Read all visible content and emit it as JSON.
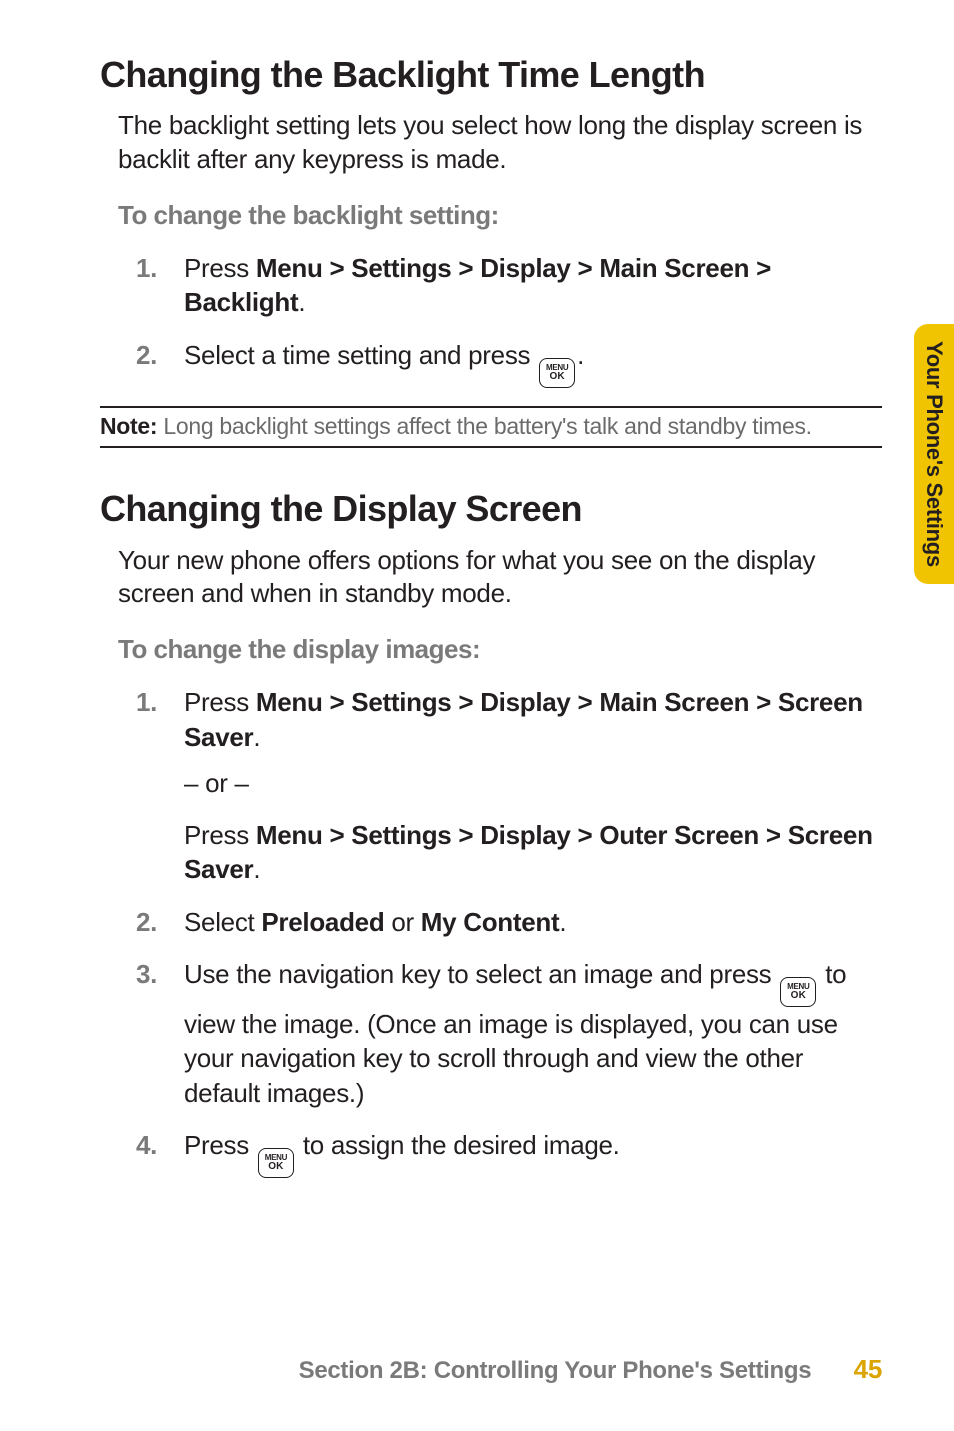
{
  "side_tab": "Your Phone's Settings",
  "section1": {
    "heading": "Changing the Backlight Time Length",
    "intro": "The backlight setting lets you select how long the display screen is backlit after any keypress is made.",
    "lead": "To change the backlight setting:",
    "step1_num": "1.",
    "step1_pre": "Press ",
    "step1_bold": "Menu > Settings > Display > Main Screen > Backlight",
    "step1_post": ".",
    "step2_num": "2.",
    "step2_pre": "Select a time setting and press ",
    "step2_post": "."
  },
  "icon": {
    "line1": "MENU",
    "line2": "OK"
  },
  "note": {
    "label": "Note:",
    "text": " Long backlight settings affect the battery's talk and standby times."
  },
  "section2": {
    "heading": "Changing the Display Screen",
    "intro": "Your new phone offers options for what you see on the display screen and when in standby mode.",
    "lead": "To change the display images:",
    "step1_num": "1.",
    "step1_pre": "Press ",
    "step1_bold1": "Menu > Settings > Display > Main Screen > Screen Saver",
    "step1_mid1": ".",
    "step1_or": "– or –",
    "step1_pre2": "Press ",
    "step1_bold2": "Menu > Settings > Display > Outer Screen > Screen Saver",
    "step1_mid2": ".",
    "step2_num": "2.",
    "step2_pre": "Select ",
    "step2_bold1": "Preloaded",
    "step2_mid": " or ",
    "step2_bold2": "My Content",
    "step2_post": ".",
    "step3_num": "3.",
    "step3_pre": "Use the navigation key to select an image and press ",
    "step3_post": " to view the image. (Once an image is displayed, you can use your navigation key to scroll through and view the other default images.)",
    "step4_num": "4.",
    "step4_pre": "Press ",
    "step4_post": " to assign the desired image."
  },
  "footer": {
    "text": "Section 2B: Controlling Your Phone's Settings",
    "page": "45"
  }
}
